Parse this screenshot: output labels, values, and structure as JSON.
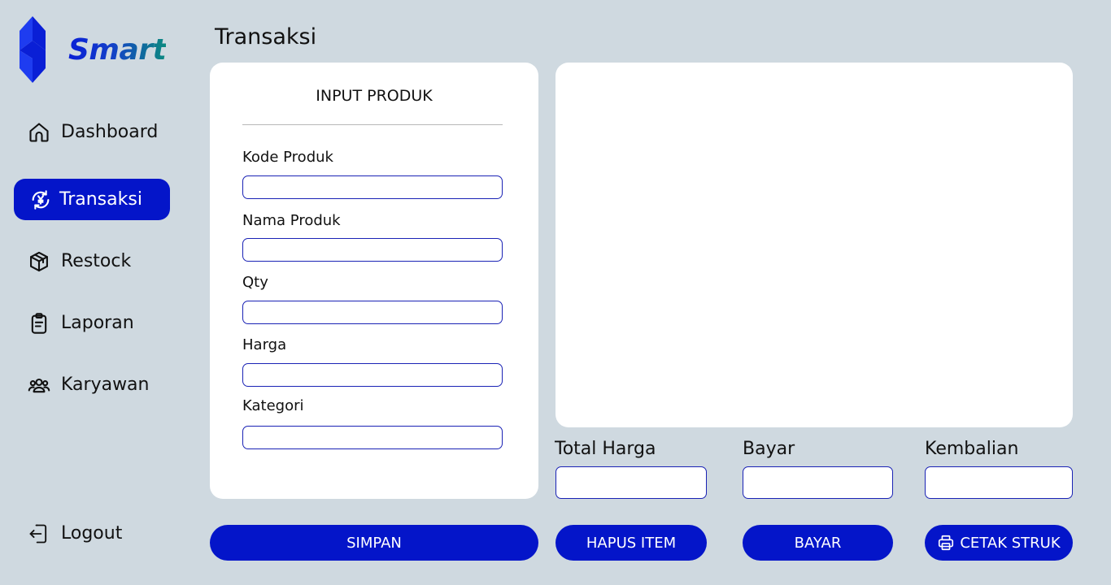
{
  "brand": {
    "name": "Smart"
  },
  "sidebar": {
    "items": [
      {
        "label": "Dashboard",
        "icon": "home-icon",
        "active": false
      },
      {
        "label": "Transaksi",
        "icon": "currency-exchange-icon",
        "active": true
      },
      {
        "label": "Restock",
        "icon": "box-icon",
        "active": false
      },
      {
        "label": "Laporan",
        "icon": "clipboard-icon",
        "active": false
      },
      {
        "label": "Karyawan",
        "icon": "users-icon",
        "active": false
      }
    ],
    "logout": {
      "label": "Logout",
      "icon": "logout-icon"
    }
  },
  "page": {
    "title": "Transaksi"
  },
  "input_card": {
    "heading": "INPUT PRODUK",
    "fields": [
      {
        "label": "Kode Produk",
        "value": ""
      },
      {
        "label": "Nama Produk",
        "value": ""
      },
      {
        "label": "Qty",
        "value": ""
      },
      {
        "label": "Harga",
        "value": ""
      },
      {
        "label": "Kategori",
        "value": ""
      }
    ]
  },
  "summary": {
    "total_label": "Total Harga",
    "total_value": "",
    "bayar_label": "Bayar",
    "bayar_value": "",
    "kembalian_label": "Kembalian",
    "kembalian_value": ""
  },
  "buttons": {
    "simpan": "SIMPAN",
    "hapus": "HAPUS ITEM",
    "bayar": "BAYAR",
    "cetak": "CETAK STRUK"
  },
  "colors": {
    "background": "#cfd9e0",
    "accent": "#0415c9",
    "card": "#ffffff",
    "input_border": "#1a22b5"
  }
}
